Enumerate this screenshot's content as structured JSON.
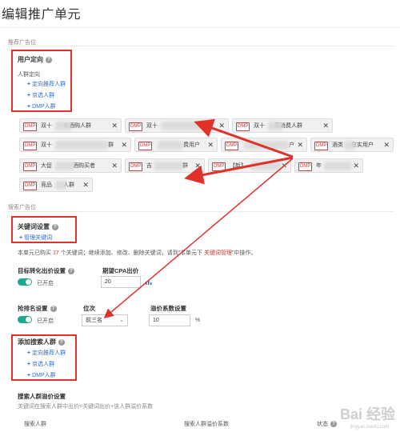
{
  "page_title": "编辑推广单元",
  "section_recommend": "推荐广告位",
  "section_search": "搜索广告位",
  "user_targeting": {
    "title": "用户定向",
    "subtitle": "人群定向",
    "links": [
      "定向推荐人群",
      "京选人群",
      "DMP人群"
    ]
  },
  "dmp_badge": "DMP",
  "close_glyph": "✕",
  "tags": [
    [
      "双十",
      "名酒购人群"
    ],
    [
      "双十",
      "户"
    ],
    [
      "双十",
      "高消费人群"
    ],
    [
      "双十",
      "群"
    ],
    [
      "",
      "费用户"
    ],
    [
      "",
      "户"
    ],
    [
      "酒类",
      "忠实用户"
    ],
    [
      "大促",
      "酒购买者"
    ],
    [
      "吉",
      "群"
    ],
    [
      "【新】",
      ""
    ],
    [
      "年",
      ""
    ],
    [
      "竞品",
      "人群"
    ]
  ],
  "keyword": {
    "title": "关键词设置",
    "manage_link": "管理关键词",
    "note_prefix": "本单元已购买",
    "note_count": "17",
    "note_mid": "个关键词；继续添加、修改、删除关键词，请到“本单元下",
    "note_link": "关键词管理",
    "note_suffix": "”中操作。"
  },
  "conversion": {
    "title": "目标转化出价设置",
    "status": "已开启",
    "cpa_title": "期望CPA出价",
    "cpa_value": "20",
    "cpa_icon": "chart-icon"
  },
  "ranking": {
    "title": "抢排名设置",
    "status": "已开启",
    "position_title": "位次",
    "position_value": "前三名",
    "coef_title": "溢价系数设置",
    "coef_value": "10",
    "coef_unit": "%"
  },
  "search_crowd": {
    "title": "添加搜索人群",
    "links": [
      "定向推荐人群",
      "京选人群",
      "DMP人群"
    ]
  },
  "premium": {
    "title": "搜索人群溢价设置",
    "desc": "关键词在搜索人群中出价=关键词出价+该人群溢价系数",
    "col1": "搜索人群",
    "col2": "搜索人群溢价系数",
    "col3": "状态"
  },
  "watermark": {
    "main": "Bai 经验",
    "sub": "jingyan.baidu.com"
  },
  "colors": {
    "accent": "#2a6bd1",
    "highlight_red": "#e0312a",
    "toggle_on": "#1ba98e"
  }
}
